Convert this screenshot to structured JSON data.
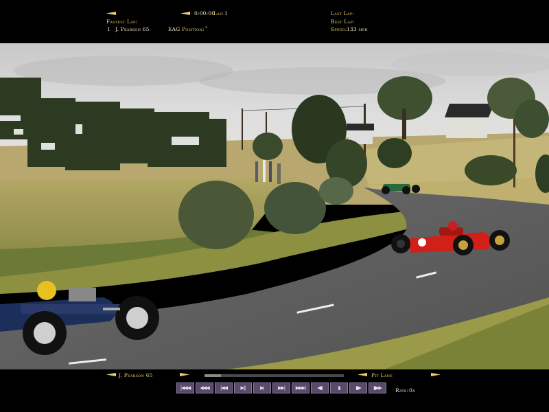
{
  "hud_top": {
    "session_time": "0:00:00",
    "lap_label": "Lap:",
    "lap_value": "1",
    "fastest_lap_label": "Fastest Lap:",
    "fastest_lap_pos": "1",
    "fastest_lap_driver": "J. Pearson 65",
    "driver_code": "EAG",
    "position_label": "Position:",
    "position_value": "\"",
    "last_lap_label": "Last Lap:",
    "best_lap_label": "Best Lap:",
    "speed_label": "Speed:",
    "speed_value": "133 mph"
  },
  "hud_bottom": {
    "driver_name": "J. Pearson 65",
    "pit_lane_label": "Pit Lane",
    "rate_label": "Rate:",
    "rate_value": "0x",
    "progress": 0.12,
    "controls": [
      "|◀◀◀",
      "◀◀◀",
      "|◀◀",
      "▶‖",
      "▶|",
      "▶▶|",
      "▶▶▶|",
      "◀▮",
      "▮",
      "▮▶",
      "▮▶▶"
    ]
  },
  "colors": {
    "hud_text": "#e8d070",
    "hud_text_white": "#ece6c8",
    "control_bg": "#5a4a6a"
  }
}
